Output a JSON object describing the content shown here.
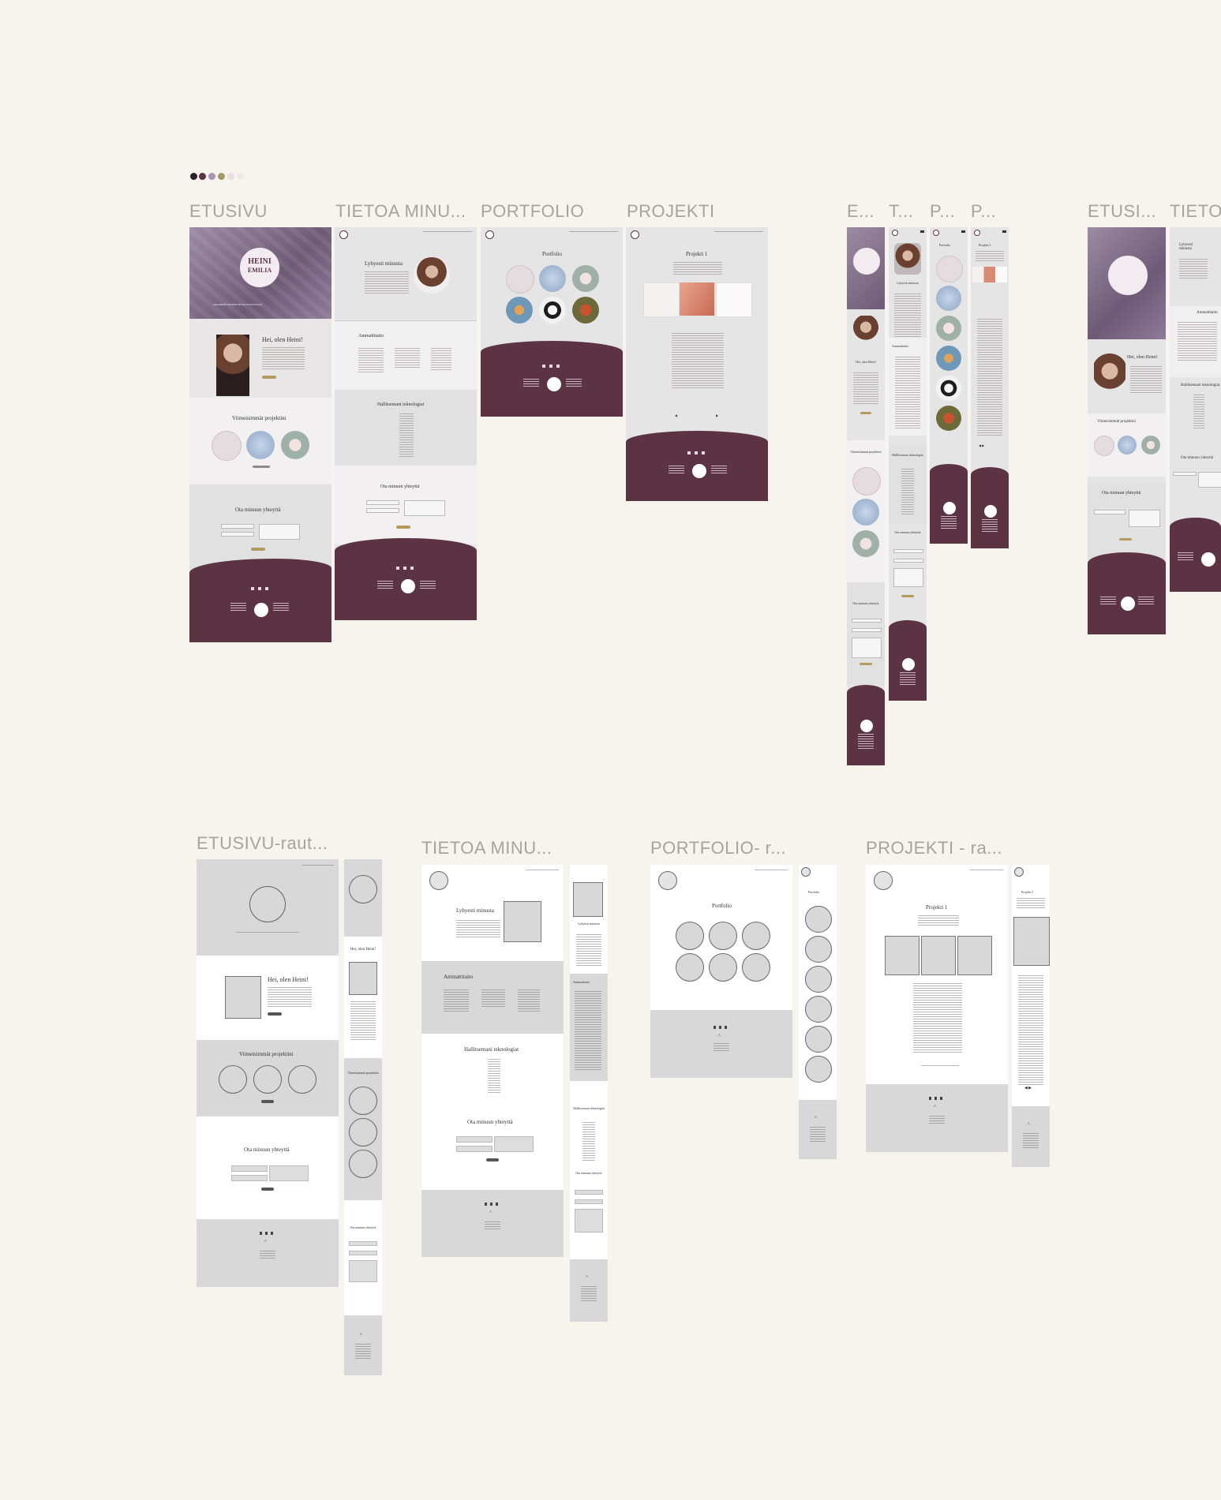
{
  "palette": {
    "swatches": [
      "#2a1f24",
      "#5c3342",
      "#a695ad",
      "#a39a6b",
      "#e8e0e4",
      "#f4eee6"
    ],
    "plum": "#5c3342",
    "lilac": "#9d8aa4",
    "light_gray": "#e6e5e5",
    "wire_gray": "#d6d6d6",
    "gold": "#b39b5e",
    "canvas": "#f7f4ee"
  },
  "frame_labels": {
    "etusivu": "ETUSIVU",
    "tietoa": "TIETOA MINU...",
    "portfolio": "PORTFOLIO",
    "projekti": "PROJEKTI",
    "m_etusivu": "E...",
    "m_tietoa": "T...",
    "m_portfolio": "P...",
    "m_projekti": "P...",
    "t_etusivu": "ETUSI...",
    "t_tietoa": "TIETOA",
    "w_etusivu": "ETUSIVU-raut...",
    "w_tietoa": "TIETOA MINU...",
    "w_portfolio": "PORTFOLIO- r...",
    "w_projekti": "PROJEKTI - ra..."
  },
  "logo": {
    "line1": "HEINI",
    "line2": "EMILIA"
  },
  "etusivu": {
    "hero_tagline": "GRAAFINEN SUUNNITTELIJA JA KUVITTAJA",
    "intro_heading": "Hei, olen Heini!",
    "projects_heading": "Viimeisimmät projektini",
    "contact_heading": "Ota minuun yhteyttä"
  },
  "tietoa": {
    "heading": "Lyhyesti minusta",
    "skills_heading": "Ammattitaito",
    "tools_heading": "Hallitsemani teknologiat",
    "contact_heading": "Ota minuun yhteyttä"
  },
  "portfolio": {
    "heading": "Portfolio"
  },
  "projekti": {
    "heading": "Projekti 1"
  },
  "mobile": {
    "intro_heading": "Hei, olen Heini!",
    "projects_heading": "Viimeisimmät projektini",
    "contact_heading": "Ota minuun yhteyttä",
    "about_heading": "Lyhyesti minusta",
    "skills_heading": "Ammattitaito",
    "tools_heading": "Hallitsemani teknologiat",
    "portfolio_heading": "Portfolio",
    "project_heading": "Projekti 1"
  },
  "wireframes": {
    "intro_heading": "Hei, olen Heini!",
    "projects_heading": "Viimeisimmät projektini",
    "contact_heading": "Ota minuun yhteyttä",
    "about_heading": "Lyhyesti minusta",
    "skills_heading": "Ammattitaito",
    "tools_heading": "Hallitsemani teknologiat",
    "portfolio_heading": "Portfolio",
    "project_heading": "Projekti 1",
    "m_intro_heading": "Hei, olen Heini!",
    "m_projects_heading": "Viimeisimmät projektini",
    "m_contact_heading": "Ota minuun yhteyttä",
    "m_about_heading": "Lyhyesti minusta",
    "m_skills_heading": "Ammattitaito",
    "m_tools_heading": "Hallitsemani teknologiat",
    "m_portfolio_heading": "Portfolio",
    "m_project_heading": "Projekti 1"
  }
}
